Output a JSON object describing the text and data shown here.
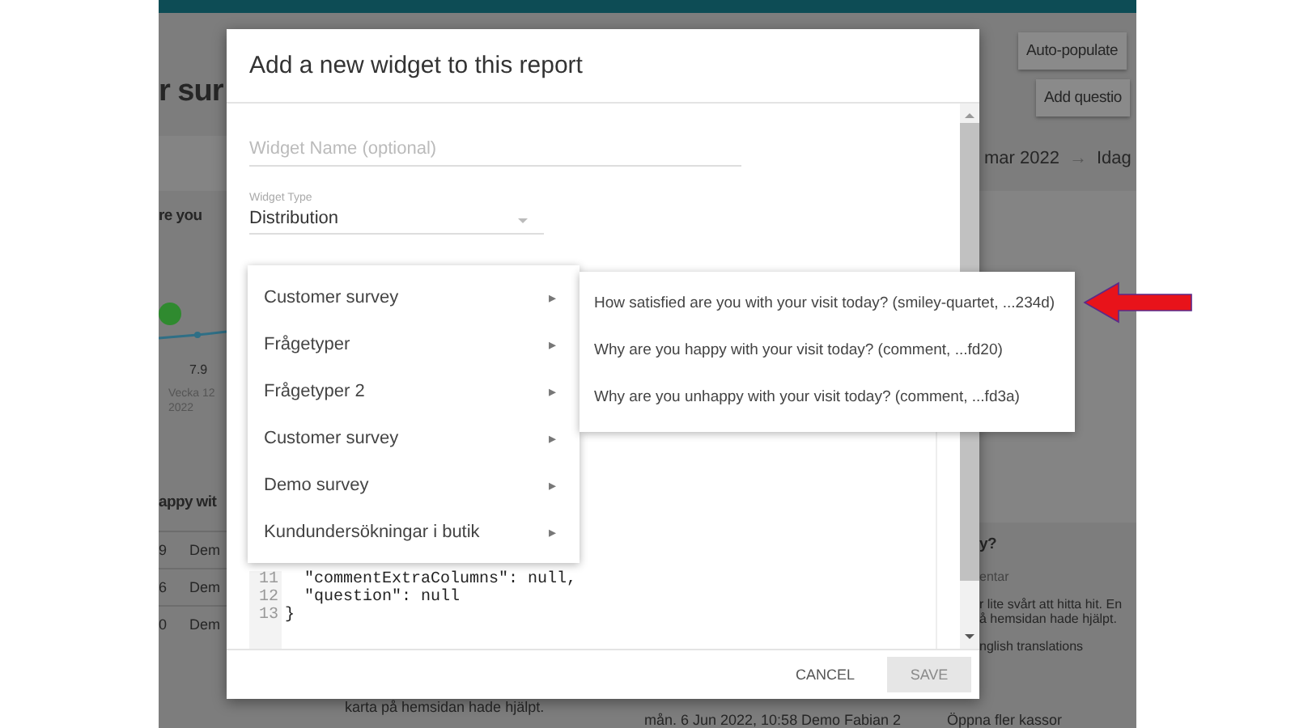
{
  "background_app": {
    "page_title": "r sur",
    "header_buttons": [
      "Auto-populate",
      "Add questio"
    ],
    "date_range": {
      "from": "mar 2022",
      "separator": "→",
      "to": "Idag"
    },
    "chart_heading": "re you",
    "chart_point": {
      "value": "7.9",
      "label_lines": [
        "Vecka 12",
        "2022"
      ]
    },
    "left_table": {
      "heading": "appy wit",
      "rows": [
        {
          "column_1": "9",
          "column_2": "Dem"
        },
        {
          "column_1": "6",
          "column_2": "Dem"
        },
        {
          "column_1": "0",
          "column_2": "Dem"
        }
      ]
    },
    "right_table": {
      "heading": "y?",
      "column_header": "entar",
      "rows": [
        {
          "lines": [
            "r lite svårt att hitta hit. En",
            "å hemsidan hade hjälpt."
          ]
        },
        {
          "lines": [
            "nglish translations"
          ]
        }
      ]
    },
    "bottom_row": {
      "comment": "karta på hemsidan hade hjälpt.",
      "date": "mån. 6 Jun 2022, 10:58",
      "survey": "Demo Fabian 2",
      "answer": "Öppna fler kassor"
    }
  },
  "dialog": {
    "title": "Add a new widget to this report",
    "name_field": {
      "placeholder": "Widget Name (optional)"
    },
    "type_field": {
      "label": "Widget Type",
      "value": "Distribution"
    },
    "code_lines": [
      {
        "number": "11",
        "text": "  \"commentExtraColumns\": null,"
      },
      {
        "number": "12",
        "text": "  \"question\": null"
      },
      {
        "number": "13",
        "text": "}"
      }
    ],
    "buttons": [
      {
        "label": "CANCEL",
        "disabled": false
      },
      {
        "label": "SAVE",
        "disabled": true
      }
    ]
  },
  "survey_menu": {
    "items": [
      {
        "label": "Customer survey",
        "arrow": "▸"
      },
      {
        "label": "Frågetyper",
        "arrow": "▸"
      },
      {
        "label": "Frågetyper 2",
        "arrow": "▸"
      },
      {
        "label": "Customer survey",
        "arrow": "▸"
      },
      {
        "label": "Demo survey",
        "arrow": "▸"
      },
      {
        "label": "Kundundersökningar i butik",
        "arrow": "▸"
      }
    ]
  },
  "question_submenu": {
    "items": [
      "How satisfied are you with your visit today? (smiley-quartet, ...234d)",
      "Why are you happy with your visit today? (comment, ...fd20)",
      "Why are you unhappy with your visit today? (comment, ...fd3a)"
    ]
  }
}
